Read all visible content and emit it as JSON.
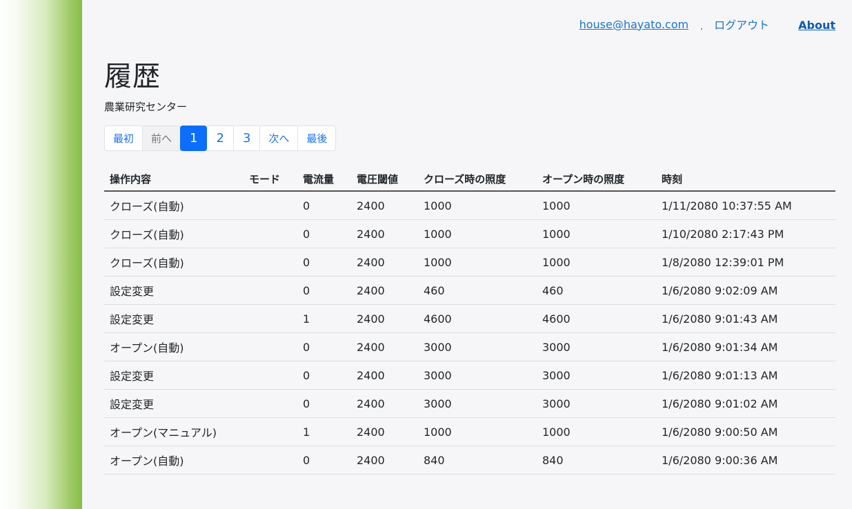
{
  "header": {
    "user_email": "house@hayato.com",
    "logout_label": "ログアウト",
    "about_label": "About"
  },
  "page": {
    "title": "履歴",
    "subtitle": "農業研究センター"
  },
  "pagination": {
    "first_label": "最初",
    "prev_label": "前へ",
    "pages": [
      "1",
      "2",
      "3"
    ],
    "current_page": "1",
    "next_label": "次へ",
    "last_label": "最後"
  },
  "table": {
    "headers": [
      "操作内容",
      "モード",
      "電流量",
      "電圧閾値",
      "クローズ時の照度",
      "オープン時の照度",
      "時刻"
    ],
    "rows": [
      {
        "operation": "クローズ(自動)",
        "mode": "",
        "current": "0",
        "voltage": "2400",
        "close_lux": "1000",
        "open_lux": "1000",
        "time": "1/11/2080 10:37:55 AM"
      },
      {
        "operation": "クローズ(自動)",
        "mode": "",
        "current": "0",
        "voltage": "2400",
        "close_lux": "1000",
        "open_lux": "1000",
        "time": "1/10/2080 2:17:43 PM"
      },
      {
        "operation": "クローズ(自動)",
        "mode": "",
        "current": "0",
        "voltage": "2400",
        "close_lux": "1000",
        "open_lux": "1000",
        "time": "1/8/2080 12:39:01 PM"
      },
      {
        "operation": "設定変更",
        "mode": "",
        "current": "0",
        "voltage": "2400",
        "close_lux": "460",
        "open_lux": "460",
        "time": "1/6/2080 9:02:09 AM"
      },
      {
        "operation": "設定変更",
        "mode": "",
        "current": "1",
        "voltage": "2400",
        "close_lux": "4600",
        "open_lux": "4600",
        "time": "1/6/2080 9:01:43 AM"
      },
      {
        "operation": "オープン(自動)",
        "mode": "",
        "current": "0",
        "voltage": "2400",
        "close_lux": "3000",
        "open_lux": "3000",
        "time": "1/6/2080 9:01:34 AM"
      },
      {
        "operation": "設定変更",
        "mode": "",
        "current": "0",
        "voltage": "2400",
        "close_lux": "3000",
        "open_lux": "3000",
        "time": "1/6/2080 9:01:13 AM"
      },
      {
        "operation": "設定変更",
        "mode": "",
        "current": "0",
        "voltage": "2400",
        "close_lux": "3000",
        "open_lux": "3000",
        "time": "1/6/2080 9:01:02 AM"
      },
      {
        "operation": "オープン(マニュアル)",
        "mode": "",
        "current": "1",
        "voltage": "2400",
        "close_lux": "1000",
        "open_lux": "1000",
        "time": "1/6/2080 9:00:50 AM"
      },
      {
        "operation": "オープン(自動)",
        "mode": "",
        "current": "0",
        "voltage": "2400",
        "close_lux": "840",
        "open_lux": "840",
        "time": "1/6/2080 9:00:36 AM"
      }
    ]
  },
  "colors": {
    "link": "#1a73c9",
    "active_page": "#0d6efd",
    "sidebar_green": "#86bd48",
    "background": "#f6f6f8"
  }
}
